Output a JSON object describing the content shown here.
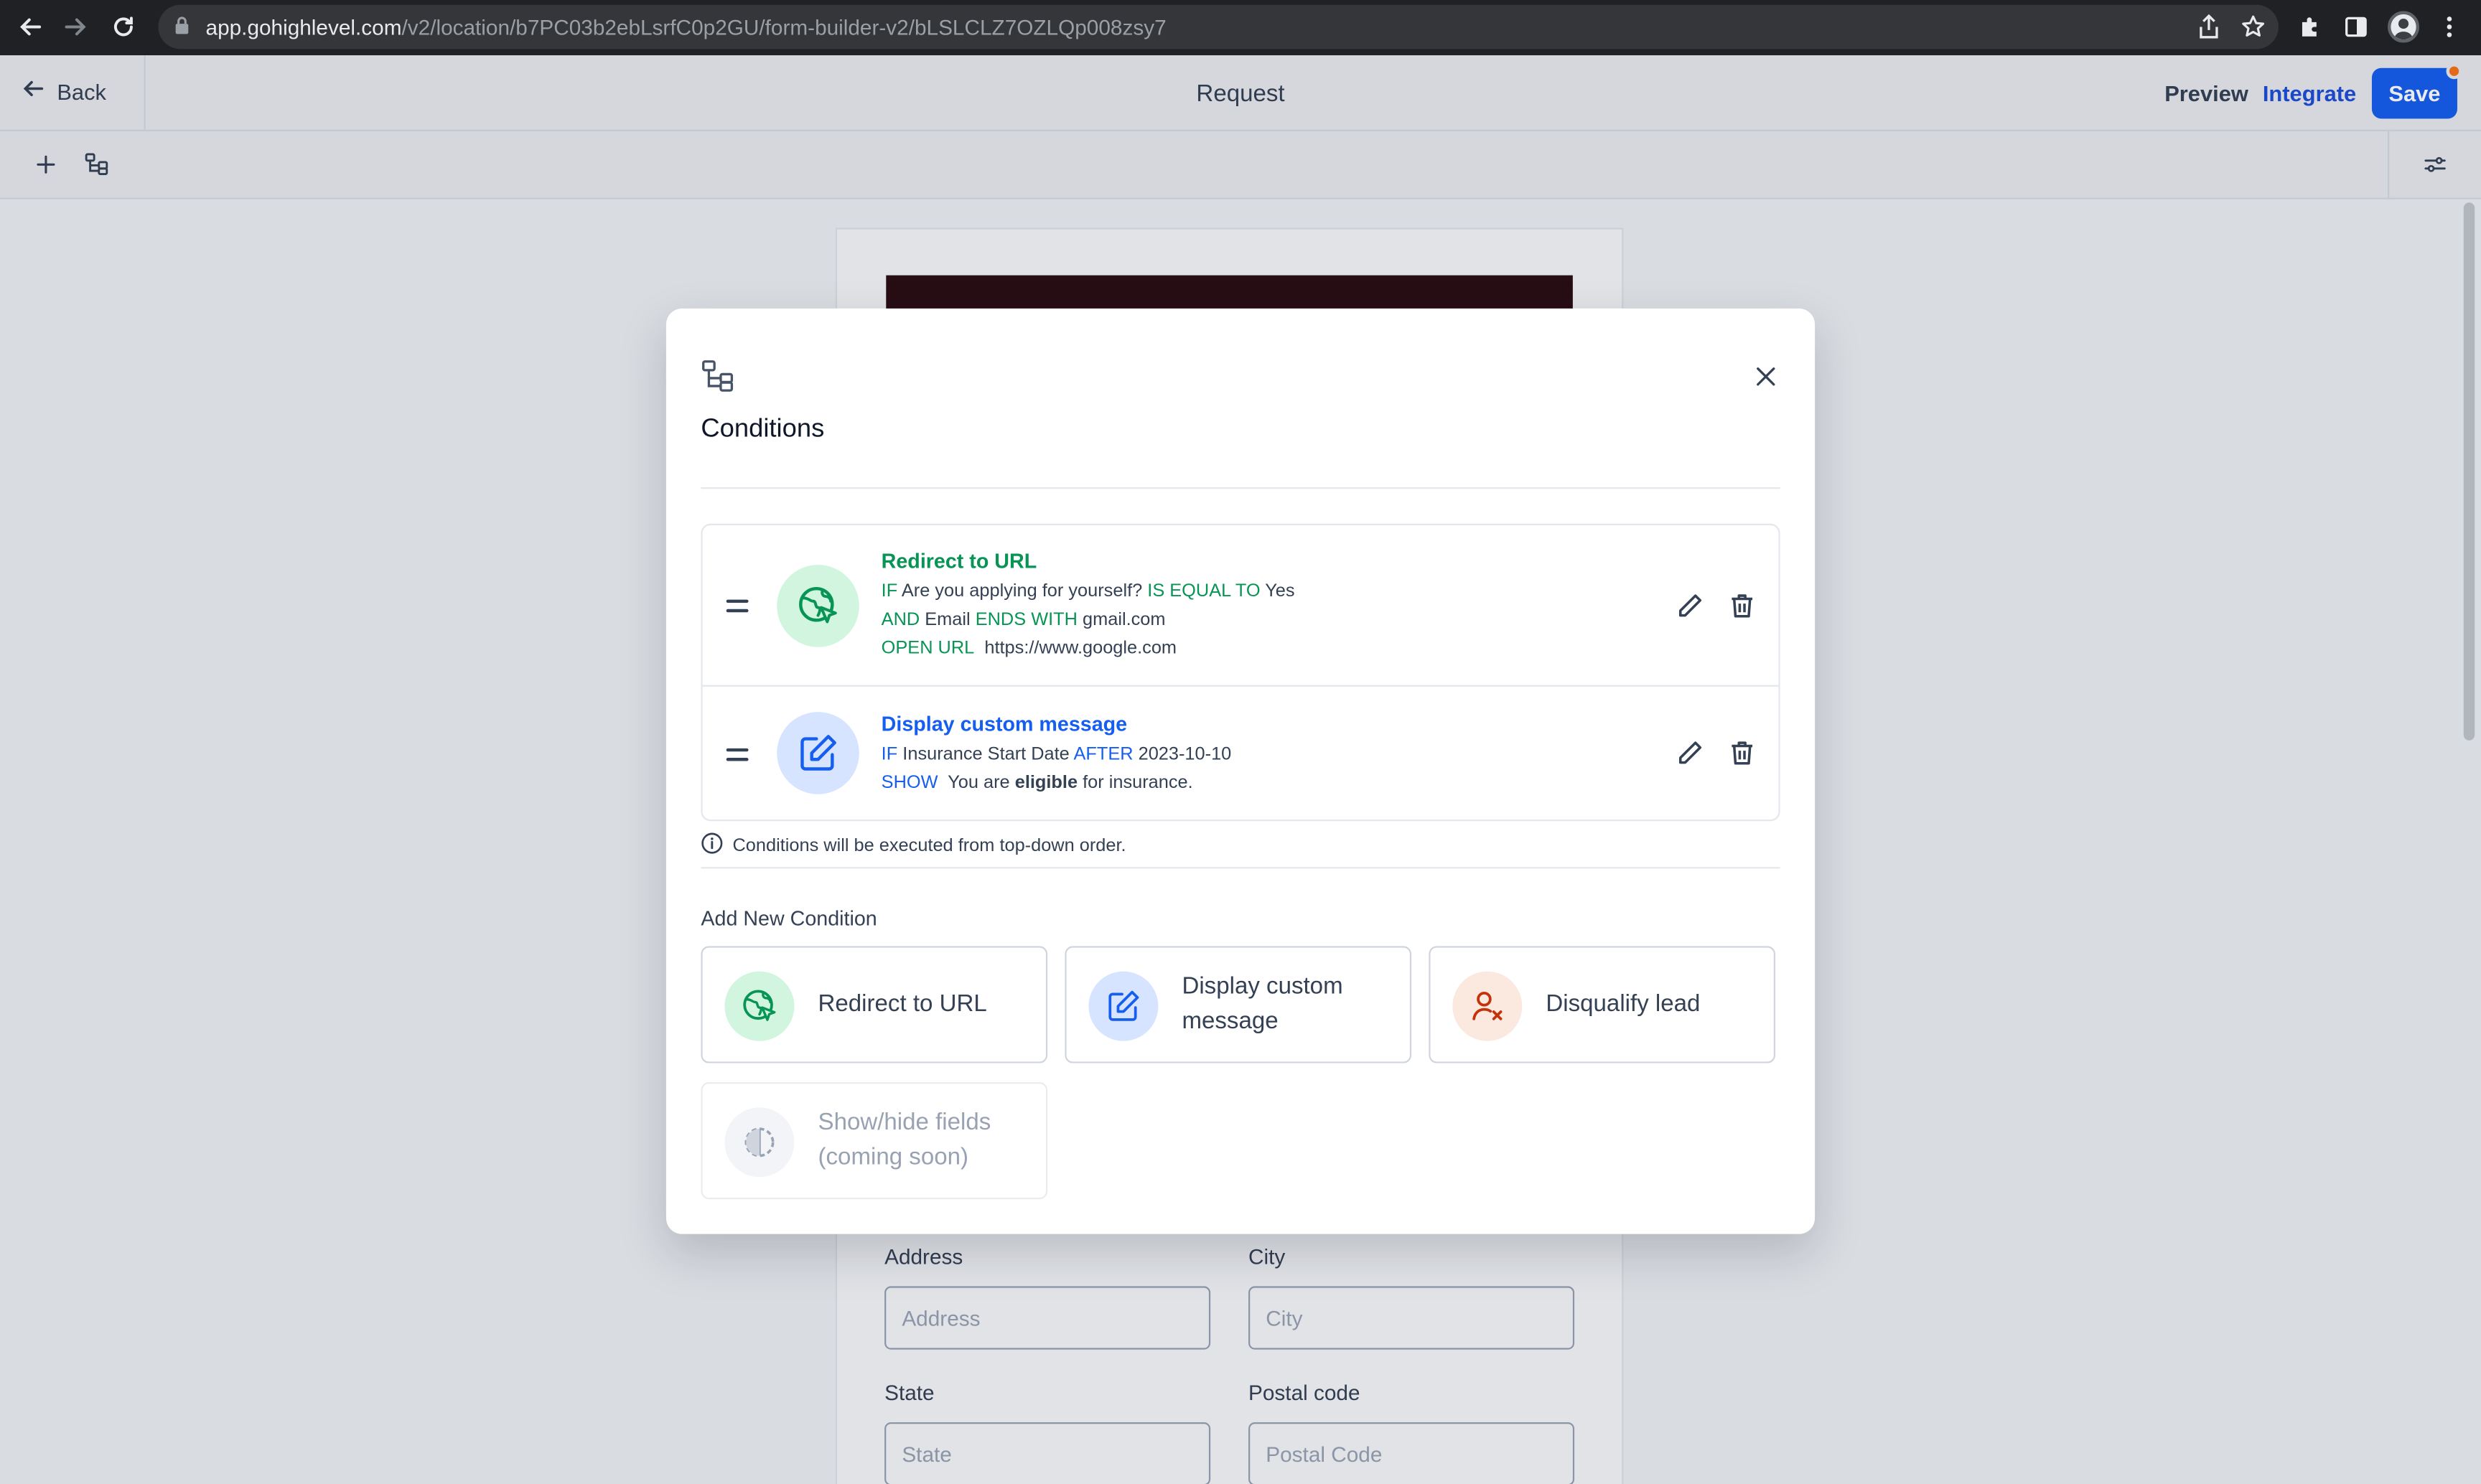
{
  "browser": {
    "url_domain": "app.gohighlevel.com",
    "url_path": "/v2/location/b7PC03b2ebLsrfC0p2GU/form-builder-v2/bLSLCLZ7OZLQp008zsy7"
  },
  "header": {
    "back_label": "Back",
    "title": "Request",
    "preview_label": "Preview",
    "integrate_label": "Integrate",
    "save_label": "Save"
  },
  "form_bg": {
    "address_label": "Address",
    "address_placeholder": "Address",
    "city_label": "City",
    "city_placeholder": "City",
    "state_label": "State",
    "state_placeholder": "State",
    "postal_label": "Postal code",
    "postal_placeholder": "Postal Code"
  },
  "modal": {
    "title": "Conditions",
    "conditions": [
      {
        "title": "Redirect to URL",
        "line1": {
          "kw1": "IF",
          "field": "Are you applying for yourself?",
          "op": "IS EQUAL TO",
          "value": "Yes"
        },
        "line2": {
          "kw1": "AND",
          "field": "Email",
          "op": "ENDS WITH",
          "value": "gmail.com"
        },
        "line3": {
          "kw1": "OPEN URL",
          "value": "https://www.google.com"
        }
      },
      {
        "title": "Display custom message",
        "line1": {
          "kw1": "IF",
          "field": "Insurance Start Date",
          "op": "AFTER",
          "value": "2023-10-10"
        },
        "line2": {
          "kw1": "SHOW",
          "pre": "You are",
          "bold": "eligible",
          "post": "for insurance."
        }
      }
    ],
    "info_note": "Conditions will be executed from top-down order.",
    "add_title": "Add New Condition",
    "options": [
      {
        "label": "Redirect to URL",
        "icon": "globe-cursor-icon"
      },
      {
        "label": "Display custom message",
        "icon": "edit-icon"
      },
      {
        "label": "Disqualify lead",
        "icon": "user-x-icon"
      },
      {
        "label": "Show/hide fields (coming soon)",
        "icon": "half-circle-icon"
      }
    ]
  },
  "colors": {
    "accent_blue": "#155eef",
    "accent_green": "#079455",
    "accent_orange": "#c4320a"
  }
}
